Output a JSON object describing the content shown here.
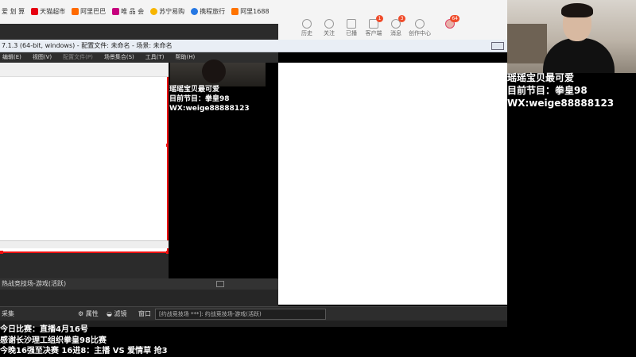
{
  "browser": {
    "bookmarks": [
      {
        "label": "爱 划 算",
        "color": "#f33"
      },
      {
        "label": "天猫超市",
        "color": "#e60012"
      },
      {
        "label": "阿里巴巴",
        "color": "#ff6a00"
      },
      {
        "label": "唯 品 会",
        "color": "#c6007e"
      },
      {
        "label": "苏宁易购",
        "color": "#f7b500"
      },
      {
        "label": "携程旅行",
        "color": "#2577e3"
      },
      {
        "label": "阿里1688",
        "color": "#ff7300"
      }
    ],
    "nav_icons": [
      {
        "label": "历史",
        "badge": ""
      },
      {
        "label": "关注",
        "badge": ""
      },
      {
        "label": "已播",
        "badge": ""
      },
      {
        "label": "客户端",
        "badge": "1"
      },
      {
        "label": "消息",
        "badge": "3"
      },
      {
        "label": "创作中心",
        "badge": ""
      },
      {
        "label": "",
        "badge": "64"
      }
    ]
  },
  "obs": {
    "title": "7.1.3 (64-bit, windows) - 配置文件: 未命名 - 场景: 未命名",
    "menu": [
      "编辑(E)",
      "视图(V)",
      "配置文件(P)",
      "场景集合(S)",
      "工具(T)",
      "帮助(H)"
    ],
    "scene_label": "热战竞技场-游戏(活跃)",
    "toolbar": {
      "left_label": "采集",
      "props": "属性",
      "filters": "滤镜",
      "window": "窗口",
      "window_field": "[约战竞技场 ***]: 约战竞技场-游戏(活跃)"
    }
  },
  "overlay": {
    "lines": [
      "瑶瑶宝贝最可爱",
      "目前节目：拳皇98",
      "WX:weige88888123"
    ]
  },
  "bottom_overlay": {
    "lines": [
      "今日比赛：直播4月16号",
      "感谢长沙理工组织拳皇98比赛",
      "今晚16强至决赛 16进8：主播 VS 爱情草 抢3"
    ]
  }
}
